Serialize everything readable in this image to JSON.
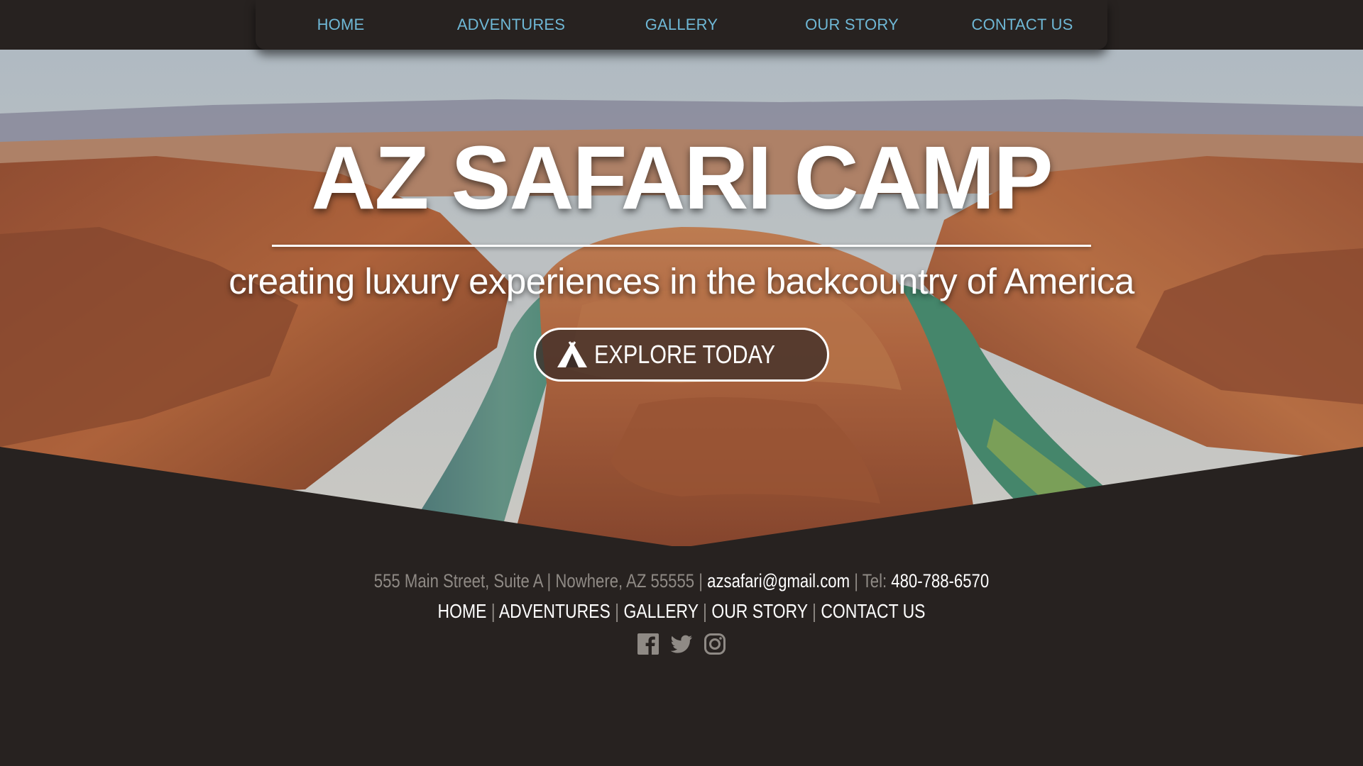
{
  "nav": {
    "items": [
      {
        "label": "HOME"
      },
      {
        "label": "ADVENTURES"
      },
      {
        "label": "GALLERY"
      },
      {
        "label": "OUR STORY"
      },
      {
        "label": "CONTACT US"
      }
    ]
  },
  "hero": {
    "title": "AZ SAFARI CAMP",
    "subtitle": "creating luxury experiences in the backcountry of America",
    "cta_label": "EXPLORE TODAY",
    "cta_icon": "tent-icon"
  },
  "footer": {
    "address": "555 Main Street, Suite A | Nowhere, AZ 55555 | ",
    "email": "azsafari@gmail.com",
    "tel_label": " | Tel: ",
    "phone": "480-788-6570",
    "separator": "|",
    "links": [
      {
        "label": "HOME"
      },
      {
        "label": "ADVENTURES"
      },
      {
        "label": "GALLERY"
      },
      {
        "label": "OUR STORY"
      },
      {
        "label": "CONTACT US"
      }
    ],
    "social": [
      "facebook-icon",
      "twitter-icon",
      "instagram-icon"
    ]
  },
  "colors": {
    "background": "#272220",
    "nav_text": "#6fb8d6",
    "footer_muted": "#8f8a85",
    "white": "#ffffff"
  }
}
